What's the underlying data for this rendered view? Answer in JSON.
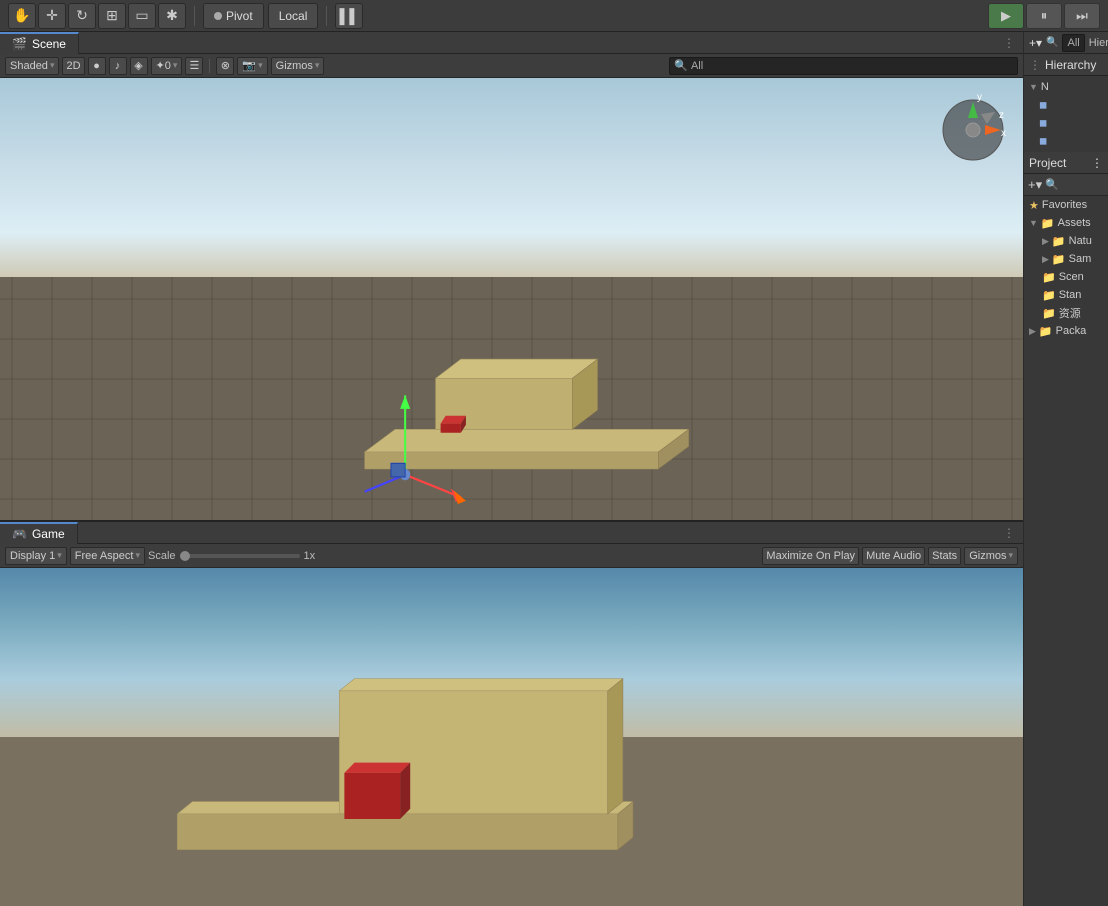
{
  "toolbar": {
    "tools": [
      "hand",
      "move",
      "rotate",
      "scale",
      "rect",
      "transform"
    ],
    "pivot_label": "Pivot",
    "local_label": "Local",
    "layers_label": "▌▌",
    "play_btn": "▶",
    "pause_btn": "⏸",
    "step_btn": "⏭"
  },
  "scene_panel": {
    "tab_label": "Scene",
    "tab_icon": "🎬",
    "more_icon": "⋮",
    "shading_label": "Shaded",
    "mode_2d": "2D",
    "gizmos_label": "Gizmos",
    "search_placeholder": "All",
    "effects_icon": "●",
    "audio_icon": "♪",
    "render_icon": "◈",
    "lighting_icon": "✦",
    "layers_icon": "☰"
  },
  "game_panel": {
    "tab_label": "Game",
    "tab_icon": "🎮",
    "more_icon": "⋮",
    "display_label": "Display 1",
    "aspect_label": "Free Aspect",
    "scale_label": "Scale",
    "scale_value": "1x",
    "maximize_label": "Maximize On Play",
    "mute_label": "Mute Audio",
    "stats_label": "Stats",
    "gizmos_label": "Gizmos"
  },
  "hierarchy": {
    "tab_label": "Hierarchy",
    "more_icon": "⋮",
    "add_icon": "+",
    "search_placeholder": "All",
    "items": [
      {
        "label": "N",
        "indent": 0,
        "arrow": "▼"
      },
      {
        "label": "",
        "indent": 1,
        "icon": "cube"
      },
      {
        "label": "",
        "indent": 1,
        "icon": "cube"
      }
    ]
  },
  "project": {
    "tab_label": "Project",
    "more_icon": "⋮",
    "add_icon": "+",
    "search_icon": "🔍",
    "favorites_label": "Favorites",
    "assets_label": "Assets",
    "folders": [
      {
        "label": "Natu",
        "expanded": false
      },
      {
        "label": "Sam",
        "expanded": false
      },
      {
        "label": "Scen",
        "expanded": false
      },
      {
        "label": "Stan",
        "expanded": false
      },
      {
        "label": "资源",
        "expanded": false
      }
    ],
    "packages_label": "Packa"
  },
  "colors": {
    "bg": "#3c3c3c",
    "panel_bg": "#383838",
    "toolbar_bg": "#3d3d3d",
    "border": "#232323",
    "tab_active": "#5588cc",
    "accent_yellow": "#e8c060",
    "accent_blue": "#5588cc"
  }
}
